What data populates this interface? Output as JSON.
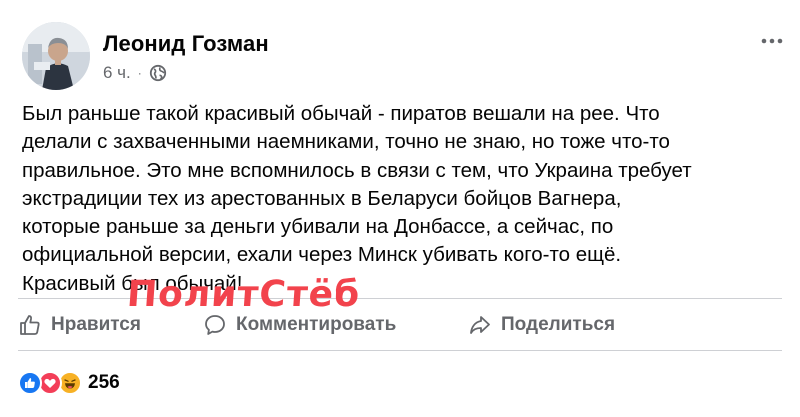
{
  "post": {
    "author": "Леонид Гозман",
    "time": "6 ч.",
    "separator": "·",
    "privacy_icon": "globe-icon",
    "text_lines": [
      "Был раньше такой красивый обычай - пиратов вешали на рее. Что",
      "делали с захваченными наемниками, точно не знаю, но тоже что-то",
      "правильное. Это мне вспомнилось в связи с тем, что Украина требует",
      "экстрадиции тех из арестованных в Беларуси бойцов Вагнера,",
      "которые раньше за деньги убивали на Донбассе, а сейчас, по",
      "официальной версии, ехали через Минск убивать кого-то ещё.",
      "Красивый был обычай!"
    ]
  },
  "watermark": "ПолитСтёб",
  "actions": {
    "like": "Нравится",
    "comment": "Комментировать",
    "share": "Поделиться"
  },
  "reactions": {
    "icons": [
      "like-reaction-icon",
      "love-reaction-icon",
      "haha-reaction-icon"
    ],
    "count": "256"
  },
  "colors": {
    "secondary_text": "#65676b",
    "divider": "#ced0d4",
    "like_blue": "#1877f2",
    "love_red": "#f33e58",
    "haha_yellow": "#f7b125",
    "watermark_red": "#f2434c"
  }
}
